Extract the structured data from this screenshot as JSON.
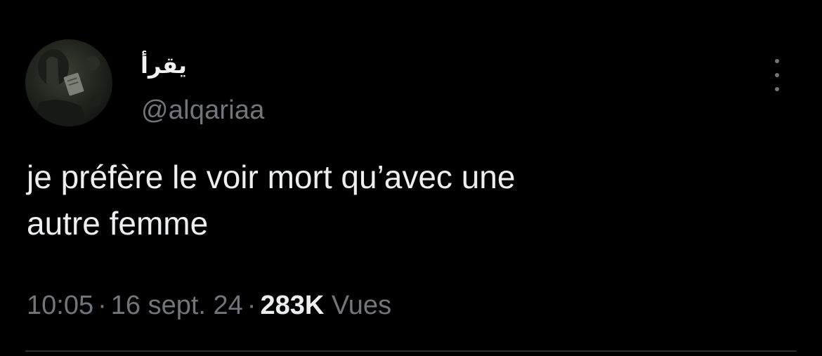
{
  "tweet": {
    "display_name": "يقرأ",
    "handle": "@alqariaa",
    "text": "je préfère le voir mort qu’avec une\nautre femme",
    "time": "10:05",
    "separator": "·",
    "date": "16 sept. 24",
    "views_count": "283K",
    "views_label": "Vues"
  },
  "icons": {
    "more": "more-vertical-icon"
  },
  "colors": {
    "background": "#000000",
    "primary_text": "#e7e9ea",
    "secondary_text": "#71767b",
    "divider": "#2a2d30"
  }
}
